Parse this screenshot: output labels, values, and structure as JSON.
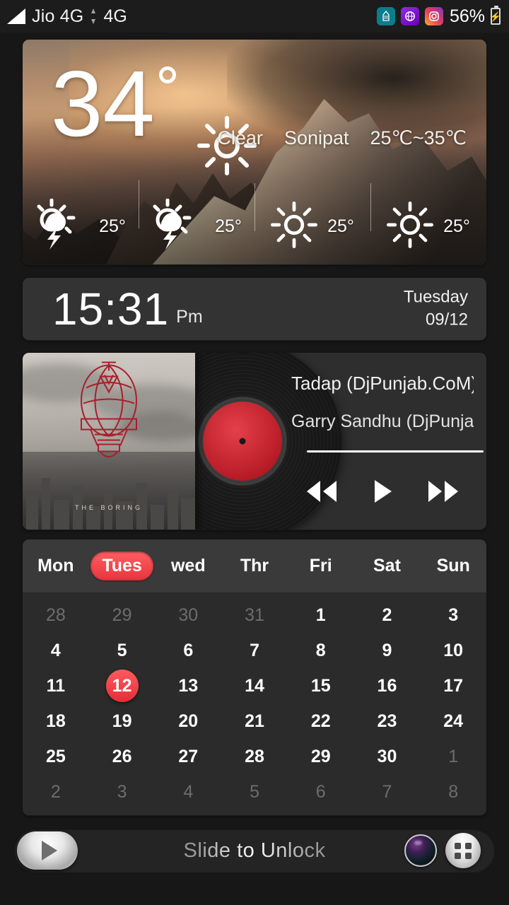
{
  "status_bar": {
    "signal_icon": "signal-bars-icon",
    "carrier": "Jio 4G",
    "data_arrow_icon": "data-transfer-icon",
    "network": "4G",
    "apps": [
      {
        "name": "jio-app-icon",
        "glyph": "▒"
      },
      {
        "name": "hotstar-app-icon",
        "glyph": "★"
      },
      {
        "name": "instagram-app-icon",
        "glyph": "◎"
      }
    ],
    "battery_percent": "56%",
    "battery_icon": "battery-charging-icon",
    "battery_bolt": "⚡"
  },
  "weather": {
    "temperature": "34",
    "degree_symbol": "°",
    "condition_icon": "sun-icon",
    "condition": "Clear",
    "location": "Sonipat",
    "range": "25℃~35℃",
    "forecast": [
      {
        "icon": "thunderstorm-icon",
        "temp": "25°"
      },
      {
        "icon": "thunderstorm-icon",
        "temp": "25°"
      },
      {
        "icon": "sun-icon",
        "temp": "25°"
      },
      {
        "icon": "sun-icon",
        "temp": "25°"
      }
    ]
  },
  "clock": {
    "time": "15:31",
    "meridiem": "Pm",
    "weekday": "Tuesday",
    "date": "09/12"
  },
  "music": {
    "album_art_caption": "THE BORING",
    "track_title": "Tadap (DjPunjab.CoM)",
    "artist": "Garry Sandhu (DjPunjab",
    "controls": [
      {
        "name": "previous-button",
        "icon": "rewind-icon"
      },
      {
        "name": "play-button",
        "icon": "play-icon"
      },
      {
        "name": "next-button",
        "icon": "fast-forward-icon"
      }
    ]
  },
  "calendar": {
    "weekdays": [
      "Mon",
      "Tues",
      "wed",
      "Thr",
      "Fri",
      "Sat",
      "Sun"
    ],
    "active_weekday": "Tues",
    "today": "12",
    "rows": [
      [
        {
          "d": "28",
          "m": "prev"
        },
        {
          "d": "29",
          "m": "prev"
        },
        {
          "d": "30",
          "m": "prev"
        },
        {
          "d": "31",
          "m": "prev"
        },
        {
          "d": "1",
          "m": "cur"
        },
        {
          "d": "2",
          "m": "cur"
        },
        {
          "d": "3",
          "m": "cur"
        }
      ],
      [
        {
          "d": "4",
          "m": "cur"
        },
        {
          "d": "5",
          "m": "cur"
        },
        {
          "d": "6",
          "m": "cur"
        },
        {
          "d": "7",
          "m": "cur"
        },
        {
          "d": "8",
          "m": "cur"
        },
        {
          "d": "9",
          "m": "cur"
        },
        {
          "d": "10",
          "m": "cur"
        }
      ],
      [
        {
          "d": "11",
          "m": "cur"
        },
        {
          "d": "12",
          "m": "today"
        },
        {
          "d": "13",
          "m": "cur"
        },
        {
          "d": "14",
          "m": "cur"
        },
        {
          "d": "15",
          "m": "cur"
        },
        {
          "d": "16",
          "m": "cur"
        },
        {
          "d": "17",
          "m": "cur"
        }
      ],
      [
        {
          "d": "18",
          "m": "cur"
        },
        {
          "d": "19",
          "m": "cur"
        },
        {
          "d": "20",
          "m": "cur"
        },
        {
          "d": "21",
          "m": "cur"
        },
        {
          "d": "22",
          "m": "cur"
        },
        {
          "d": "23",
          "m": "cur"
        },
        {
          "d": "24",
          "m": "cur"
        }
      ],
      [
        {
          "d": "25",
          "m": "cur"
        },
        {
          "d": "26",
          "m": "cur"
        },
        {
          "d": "27",
          "m": "cur"
        },
        {
          "d": "28",
          "m": "cur"
        },
        {
          "d": "29",
          "m": "cur"
        },
        {
          "d": "30",
          "m": "cur"
        },
        {
          "d": "1",
          "m": "next"
        }
      ],
      [
        {
          "d": "2",
          "m": "next"
        },
        {
          "d": "3",
          "m": "next"
        },
        {
          "d": "4",
          "m": "next"
        },
        {
          "d": "5",
          "m": "next"
        },
        {
          "d": "6",
          "m": "next"
        },
        {
          "d": "7",
          "m": "next"
        },
        {
          "d": "8",
          "m": "next"
        }
      ]
    ]
  },
  "unlock": {
    "slider_icon": "play-arrow-icon",
    "label": "Slide to Unlock",
    "camera_icon": "camera-lens-icon",
    "drawer_icon": "app-drawer-icon"
  },
  "colors": {
    "background": "#171717",
    "panel": "#333333",
    "accent_red": "#ee3a41",
    "text": "#ffffff",
    "dim_text": "#6d6d6d"
  }
}
